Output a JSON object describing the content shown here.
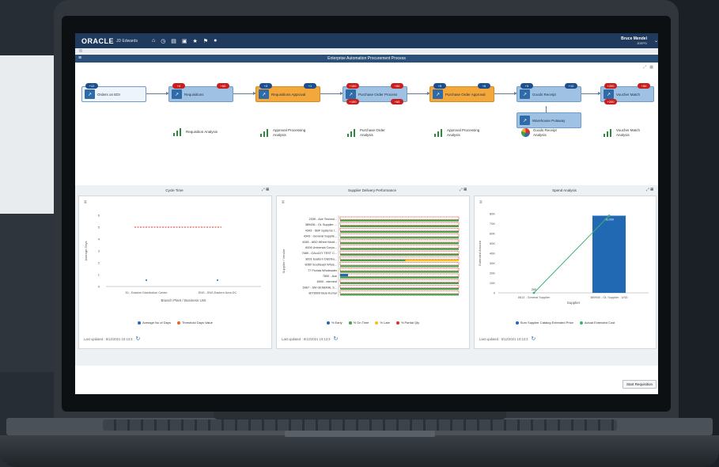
{
  "header": {
    "logo": "ORACLE",
    "logo_sub": "JD Edwards",
    "user_name": "Bruce Mendel",
    "user_role": "JDEPD",
    "icons": [
      "home-icon",
      "history-icon",
      "list-icon",
      "document-icon",
      "favorite-icon",
      "flag-icon",
      "bell-icon"
    ]
  },
  "page_title": "Enterprise Automation Procurement Process",
  "flow": {
    "nodes": [
      {
        "label": "Orders on EDI",
        "badge_blue": "+12",
        "badge_red": ""
      },
      {
        "label": "Requisitions",
        "badge_blue": "+4",
        "badge_red": "+60"
      },
      {
        "label": "Requisitions Approval",
        "badge_blue": "+3",
        "badge_red": "+1"
      },
      {
        "label": "Purchase Order Process",
        "badge_blue": "+100",
        "badge_red": "+60"
      },
      {
        "label": "Purchase Order Approval",
        "badge_blue": "+5",
        "badge_red": "+6"
      },
      {
        "label": "Goods Receipt",
        "badge_blue": "+3",
        "badge_red": "+10"
      },
      {
        "label": "Voucher Match",
        "badge_blue": "+200",
        "badge_red": "+50"
      }
    ],
    "sub_node": "Warehouse Putaway",
    "analyses": [
      "Requisition Analysis",
      "Approval Processing Analysis",
      "Purchase Order Analysis",
      "Approval Processing Analysis",
      "Goods Receipt Analysis",
      "Voucher Match Analysis"
    ]
  },
  "panels": [
    {
      "title": "Cycle Time",
      "updated": "Last updated : 6/12/2021 10:13:3",
      "xlabel": "Branch Plant / Business Unit",
      "ylabel": "Average Days",
      "legend": [
        "Average No of Days",
        "Threshold Days Value"
      ]
    },
    {
      "title": "Supplier Delivery Performance",
      "updated": "Last updated : 6/12/2021 10:13:3",
      "ylabel": "Supplier / Vendor",
      "legend": [
        "% Early",
        "% On Time",
        "% Late",
        "% Partial Qty"
      ]
    },
    {
      "title": "Spend Analysis",
      "updated": "Last updated : 6/12/2021 10:13:3",
      "xlabel": "Supplier",
      "ylabel": "Extended Amount",
      "legend": [
        "Sum Supplier Catalog Extended Price",
        "Actual Extended Cost"
      ]
    }
  ],
  "chart_data": [
    {
      "type": "line",
      "title": "Cycle Time",
      "categories": [
        "30 - Eastern Distribution Center",
        "ENS - ENS Eastern Area DC"
      ],
      "series": [
        {
          "name": "Average No of Days",
          "values": [
            0,
            0
          ]
        },
        {
          "name": "Threshold Days Value",
          "values": [
            5,
            5
          ]
        }
      ],
      "ylim": [
        0,
        6
      ],
      "yticks": [
        "6",
        "5",
        "4",
        "3",
        "2",
        "1",
        "0"
      ],
      "xlabel": "Branch Plant / Business Unit",
      "ylabel": "Average Days"
    },
    {
      "type": "bar",
      "title": "Supplier Delivery Performance",
      "categories": [
        "2339 - Ace Technol...",
        "389436 - OL Supplier ...",
        "4343 - SBF Systems I...",
        "4343 - General Supplie...",
        "4345 - ABO Wheel Mold...",
        "6006 Universal Corpo...",
        "7689 - GALAXY TEST C...",
        "8001 Eastern Distribu...",
        "8060 Southeast Whse...",
        "77 Florida Wholesaler",
        "7800 - Ace",
        "6900 - element",
        "6967 - SM GENERAL S...",
        "8078909 Bela Kumar"
      ],
      "series": [
        {
          "name": "% Early",
          "values": []
        },
        {
          "name": "% On Time",
          "values": []
        },
        {
          "name": "% Late",
          "values": []
        },
        {
          "name": "% Partial Qty",
          "values": []
        }
      ],
      "ylabel": "Supplier / Vendor"
    },
    {
      "type": "bar",
      "title": "Spend Analysis",
      "categories": [
        "6613 - General Supplier",
        "389930 - OL Supplier - USD"
      ],
      "series": [
        {
          "name": "Sum Supplier Catalog Extended Price",
          "values": [
            0,
            78000
          ]
        },
        {
          "name": "Actual Extended Cost",
          "values": [
            0,
            78000
          ]
        }
      ],
      "data_labels": [
        "200",
        "78,000"
      ],
      "ylim": [
        0,
        80000
      ],
      "yticks": [
        "80K",
        "70K",
        "60K",
        "50K",
        "40K",
        "30K",
        "20K",
        "10K",
        "0"
      ],
      "xlabel": "Supplier",
      "ylabel": "Extended Amount"
    }
  ],
  "footer": {
    "start_button": "Start Requisition"
  },
  "colors": {
    "header": "#1f3a5c",
    "node": "#9fc2e4",
    "node_active": "#f4a83c",
    "badge_red": "#c81e1e",
    "badge_blue": "#1c4f8e",
    "bar": "#2169b3",
    "line": "#3cb371"
  }
}
